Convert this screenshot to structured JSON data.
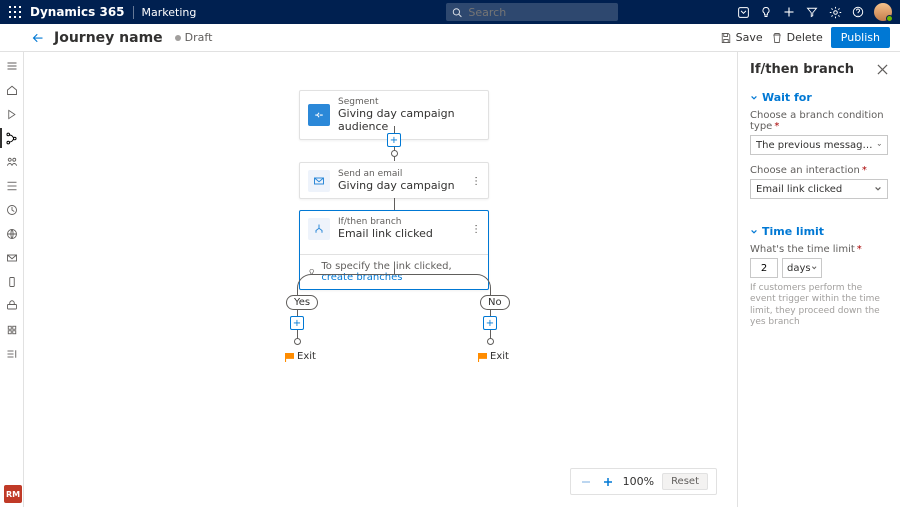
{
  "app": {
    "brand": "Dynamics 365",
    "area": "Marketing",
    "search_placeholder": "Search"
  },
  "header": {
    "back_title": "Back",
    "title": "Journey name",
    "status": "Draft",
    "save": "Save",
    "delete": "Delete",
    "publish": "Publish"
  },
  "canvas": {
    "segment": {
      "type": "Segment",
      "title": "Giving day campaign audience"
    },
    "email": {
      "type": "Send an email",
      "title": "Giving day campaign"
    },
    "branch": {
      "type": "If/then branch",
      "title": "Email link clicked",
      "hint_prefix": "To specify the link clicked, ",
      "hint_link": "create branches"
    },
    "yes": "Yes",
    "no": "No",
    "exit": "Exit"
  },
  "zoom": {
    "level": "100%",
    "reset": "Reset"
  },
  "panel": {
    "title": "If/then branch",
    "section_wait": "Wait for",
    "cond_label": "Choose a branch condition type",
    "cond_value": "The previous message gets an interaction",
    "interaction_label": "Choose an interaction",
    "interaction_value": "Email link clicked",
    "section_time": "Time limit",
    "time_label": "What's the time limit",
    "time_value": "2",
    "time_unit": "days",
    "time_help": "If customers perform the event trigger within the time limit, they proceed down the yes branch"
  },
  "rm": "RM"
}
